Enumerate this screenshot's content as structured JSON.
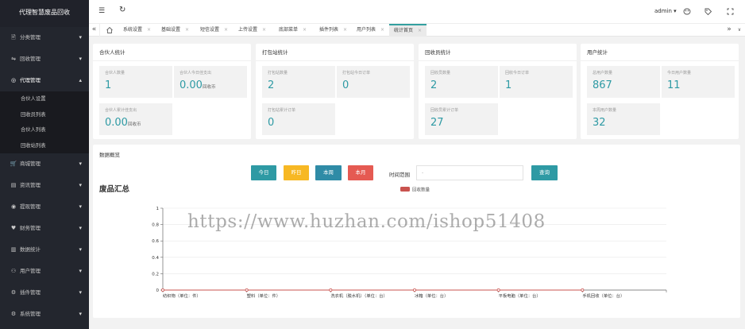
{
  "brand": "代理智慧废品回收",
  "sidebar": {
    "items": [
      {
        "icon": "🖹",
        "label": "分类管理"
      },
      {
        "icon": "⇋",
        "label": "回收管理"
      },
      {
        "icon": "◎",
        "label": "代理管理"
      },
      {
        "icon": "🛒",
        "label": "商城管理"
      },
      {
        "icon": "▤",
        "label": "资讯管理"
      },
      {
        "icon": "◉",
        "label": "提现管理"
      },
      {
        "icon": "♥",
        "label": "财务管理"
      },
      {
        "icon": "▥",
        "label": "数据统计"
      },
      {
        "icon": "⚇",
        "label": "用户管理"
      },
      {
        "icon": "⚙",
        "label": "插件管理"
      },
      {
        "icon": "⚙",
        "label": "系统管理"
      }
    ],
    "submenu": [
      "合伙人设置",
      "回收员列表",
      "合伙人列表",
      "回收站列表"
    ]
  },
  "topbar": {
    "user": "admin ▾",
    "menu_icon": "☰",
    "refresh_icon": "↻"
  },
  "tabs": [
    "系统设置",
    "基础设置",
    "短信设置",
    "上传设置",
    "底部菜单",
    "插件列表",
    "用户列表",
    "统计首页"
  ],
  "cards": [
    {
      "title": "合伙人统计",
      "stats": [
        {
          "label": "合伙人数量",
          "value": "1",
          "unit": ""
        },
        {
          "label": "合伙人今日佳支出",
          "value": "0.00",
          "unit": "回收币"
        },
        {
          "label": "合伙人累计佳支出",
          "value": "0.00",
          "unit": "回收币"
        }
      ]
    },
    {
      "title": "打包站统计",
      "stats": [
        {
          "label": "打包站数量",
          "value": "2",
          "unit": ""
        },
        {
          "label": "打包站今日订单",
          "value": "0",
          "unit": ""
        },
        {
          "label": "打包站累计订单",
          "value": "0",
          "unit": ""
        }
      ]
    },
    {
      "title": "回收员统计",
      "stats": [
        {
          "label": "回收员数量",
          "value": "2",
          "unit": ""
        },
        {
          "label": "回收今日订单",
          "value": "1",
          "unit": ""
        },
        {
          "label": "回收员累计订单",
          "value": "27",
          "unit": ""
        }
      ]
    },
    {
      "title": "用户统计",
      "stats": [
        {
          "label": "总用户数量",
          "value": "867",
          "unit": ""
        },
        {
          "label": "今日用户数量",
          "value": "11",
          "unit": ""
        },
        {
          "label": "本周用户数量",
          "value": "32",
          "unit": ""
        }
      ]
    }
  ],
  "overview": {
    "title": "数据概览",
    "buttons": {
      "today": "今日",
      "yesterday": "昨日",
      "week": "本周",
      "month": "本月",
      "query": "查询"
    },
    "time_range_label": "时间范围",
    "time_range_placeholder": "-"
  },
  "chart_data": {
    "type": "line",
    "title": "废品汇总",
    "categories": [
      "纺织物（单位：件）",
      "塑料（单位：件）",
      "洗衣机（脱水机）（单位：台）",
      "冰箱（单位：台）",
      "平板电脑（单位：台）",
      "手机回收（单位：台）"
    ],
    "series": [
      {
        "name": "回收数量",
        "values": [
          0,
          0,
          0,
          0,
          0,
          0
        ]
      }
    ],
    "ylim": [
      0,
      1
    ],
    "yticks": [
      "0",
      "0.2",
      "0.4",
      "0.6",
      "0.8",
      "1"
    ],
    "legend": "top-center",
    "series_color": "#c9534f"
  },
  "watermark": "https://www.huzhan.com/ishop51408"
}
